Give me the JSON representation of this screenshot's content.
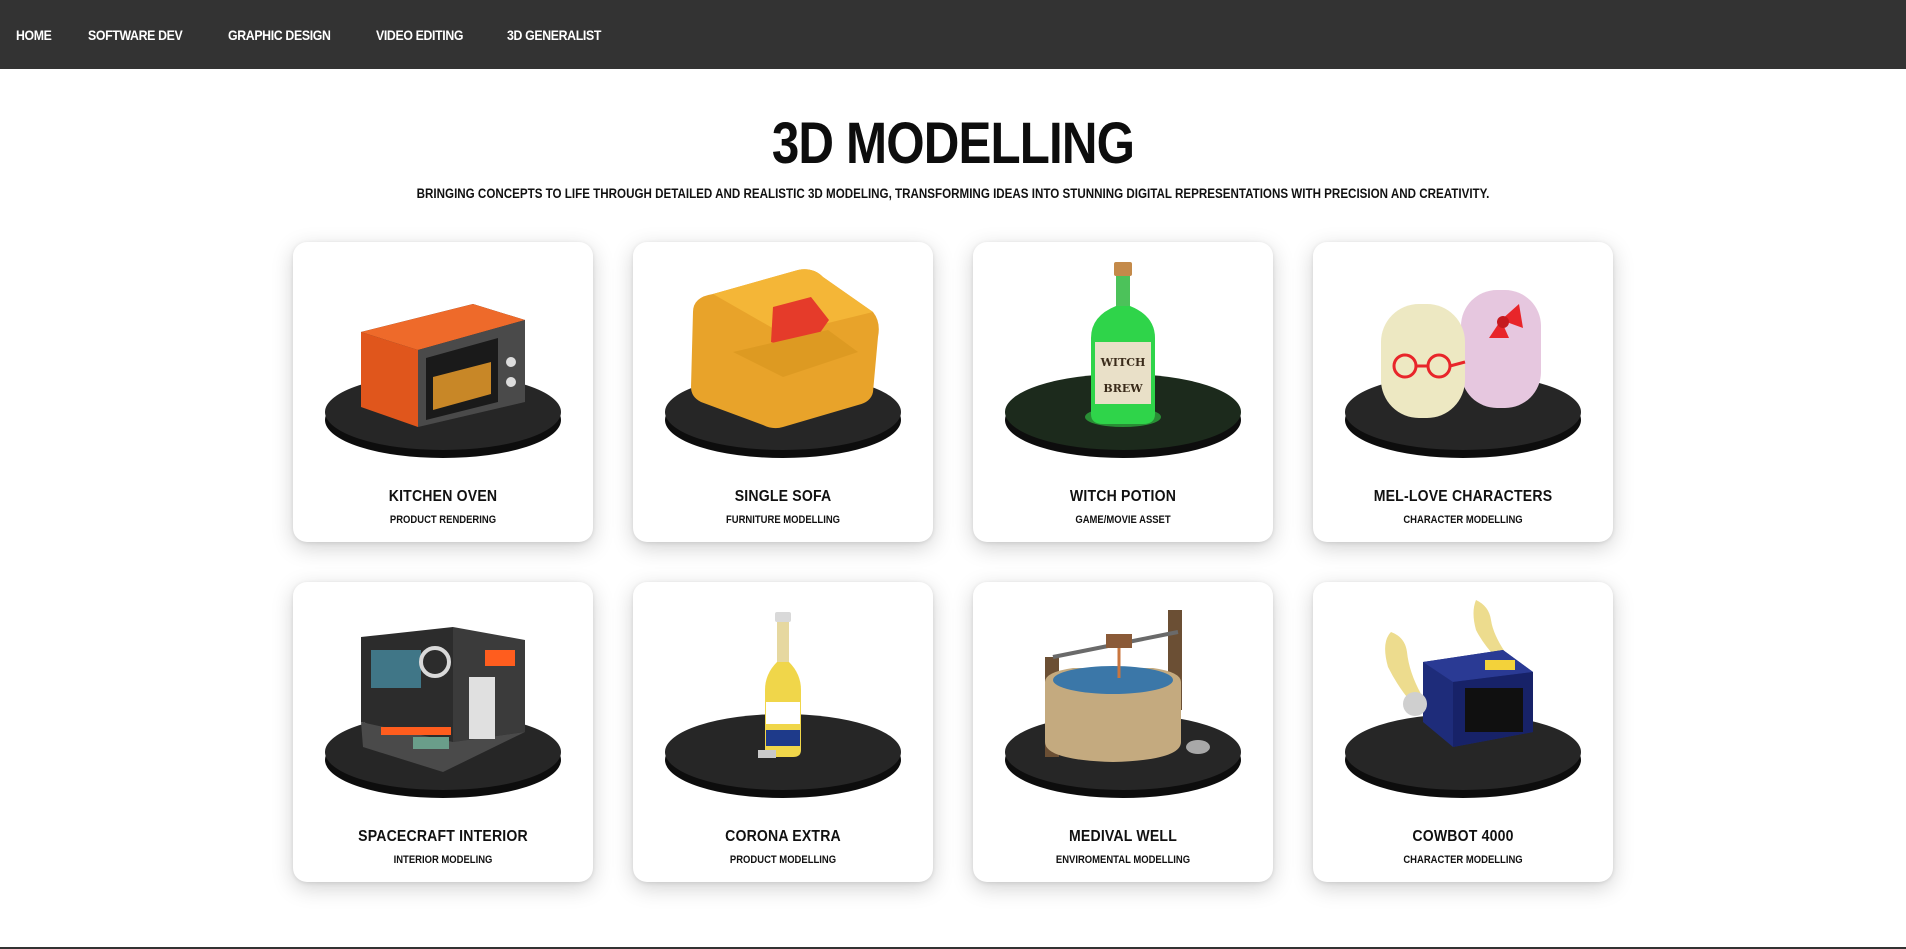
{
  "nav": {
    "items": [
      {
        "label": "HOME"
      },
      {
        "label": "SOFTWARE DEV"
      },
      {
        "label": "GRAPHIC DESIGN"
      },
      {
        "label": "VIDEO EDITING"
      },
      {
        "label": "3D GENERALIST"
      }
    ]
  },
  "page": {
    "title": "3D MODELLING",
    "subtitle": "BRINGING CONCEPTS TO LIFE THROUGH DETAILED AND REALISTIC 3D MODELING, TRANSFORMING IDEAS INTO STUNNING DIGITAL REPRESENTATIONS WITH PRECISION AND CREATIVITY."
  },
  "cards": [
    {
      "title": "KITCHEN OVEN",
      "subtitle": "PRODUCT RENDERING",
      "icon": "oven-icon"
    },
    {
      "title": "SINGLE SOFA",
      "subtitle": "FURNITURE MODELLING",
      "icon": "sofa-icon"
    },
    {
      "title": "WITCH POTION",
      "subtitle": "GAME/MOVIE ASSET",
      "icon": "potion-bottle-icon"
    },
    {
      "title": "MEL-LOVE CHARACTERS",
      "subtitle": "CHARACTER MODELLING",
      "icon": "marshmallow-characters-icon"
    },
    {
      "title": "SPACECRAFT INTERIOR",
      "subtitle": "INTERIOR MODELING",
      "icon": "spacecraft-room-icon"
    },
    {
      "title": "CORONA EXTRA",
      "subtitle": "PRODUCT MODELLING",
      "icon": "beer-bottle-icon"
    },
    {
      "title": "MEDIVAL WELL",
      "subtitle": "ENVIROMENTAL MODELLING",
      "icon": "stone-well-icon"
    },
    {
      "title": "COWBOT 4000",
      "subtitle": "CHARACTER MODELLING",
      "icon": "cube-robot-icon"
    }
  ],
  "colors": {
    "nav_bg": "#333333",
    "nav_text": "#ffffff",
    "page_bg": "#ffffff",
    "card_bg": "#ffffff",
    "pedestal": "#1f1f1f"
  }
}
